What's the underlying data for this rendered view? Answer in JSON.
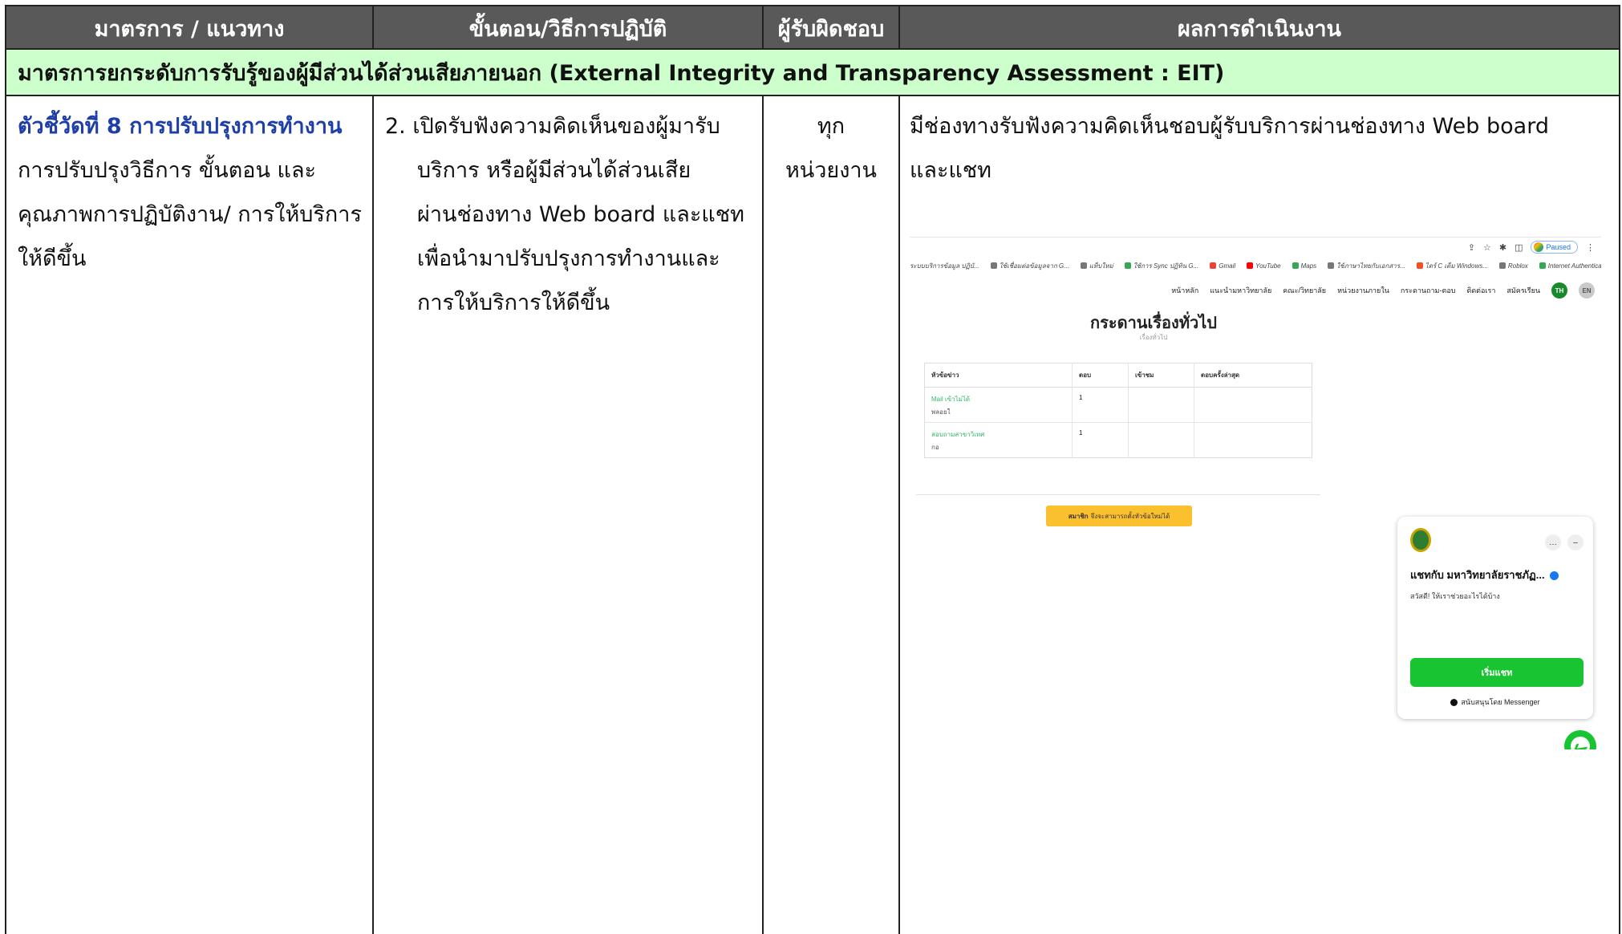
{
  "header": {
    "col1": "มาตรการ / แนวทาง",
    "col2": "ขั้นตอน/วิธีการปฏิบัติ",
    "col3": "ผู้รับผิดชอบ",
    "col4": "ผลการดำเนินงาน"
  },
  "section": {
    "title": "มาตรการยกระดับการรับรู้ของผู้มีส่วนได้ส่วนเสียภายนอก (External Integrity and Transparency Assessment : EIT)"
  },
  "row": {
    "kpi": "ตัวชี้วัดที่ 8 การปรับปรุงการทำงาน",
    "measure": [
      "การปรับปรุงวิธีการ ขั้นตอน และ",
      "คุณภาพการปฏิบัติงาน/ การให้บริการ",
      "ให้ดีขึ้น"
    ],
    "step_first": "2. เปิดรับฟังความคิดเห็นของผู้มารับ",
    "step_rest": [
      "บริการ หรือผู้มีส่วนได้ส่วนเสีย",
      "ผ่านช่องทาง Web board และแชท",
      "เพื่อนำมาปรับปรุงการทำงานและ",
      "การให้บริการให้ดีขึ้น"
    ],
    "owner": [
      "ทุก",
      "หน่วยงาน"
    ],
    "result": [
      "มีช่องทางรับฟังความคิดเห็นชอบผู้รับบริการผ่านช่องทาง Web board",
      "และแชท"
    ]
  },
  "screenshot": {
    "paused_label": "Paused",
    "bookmarks": [
      "ระบบบริการข้อมูล ปฏิบั...",
      "ใช้เชื่อมต่อข้อมูลจาก G...",
      "แท็บใหม่",
      "ใช้การ Sync ปฏิทิน G...",
      "Gmail",
      "YouTube",
      "Maps",
      "ใช้ภาษาไทยกับเอกสาร...",
      "ไดร์ C เต็ม Windows...",
      "Roblox",
      "Internet Authentica..."
    ],
    "nav": [
      "หน้าหลัก",
      "แนะนำมหาวิทยาลัย",
      "คณะ/วิทยาลัย",
      "หน่วยงานภายใน",
      "กระดานถาม-ตอบ",
      "ติดต่อเรา",
      "สมัครเรียน"
    ],
    "lang_th": "TH",
    "lang_en": "EN",
    "board_title": "กระดานเรื่องทั่วไป",
    "board_subtitle": "เรื่องทั่วไป",
    "table_headers": [
      "หัวข้อข่าว",
      "ตอบ",
      "เข้าชม",
      "ตอบครั้งล่าสุด"
    ],
    "rows": [
      {
        "topic": "Mail เข้าไม่ได้",
        "by": "พลอยใ",
        "replies": "1"
      },
      {
        "topic": "สอบถามสาขาวิเทศ",
        "by": "กอ",
        "replies": "1"
      }
    ],
    "member_bold": "สมาชิก",
    "member_text": "จึงจะสามารถตั้งหัวข้อใหม่ได้",
    "chat_name": "แชทกับ มหาวิทยาลัยราชภัฏ...",
    "chat_greeting": "สวัสดี! ให้เราช่วยอะไรได้บ้าง",
    "chat_start": "เริ่มแชท",
    "chat_powered": "สนับสนุนโดย Messenger"
  }
}
